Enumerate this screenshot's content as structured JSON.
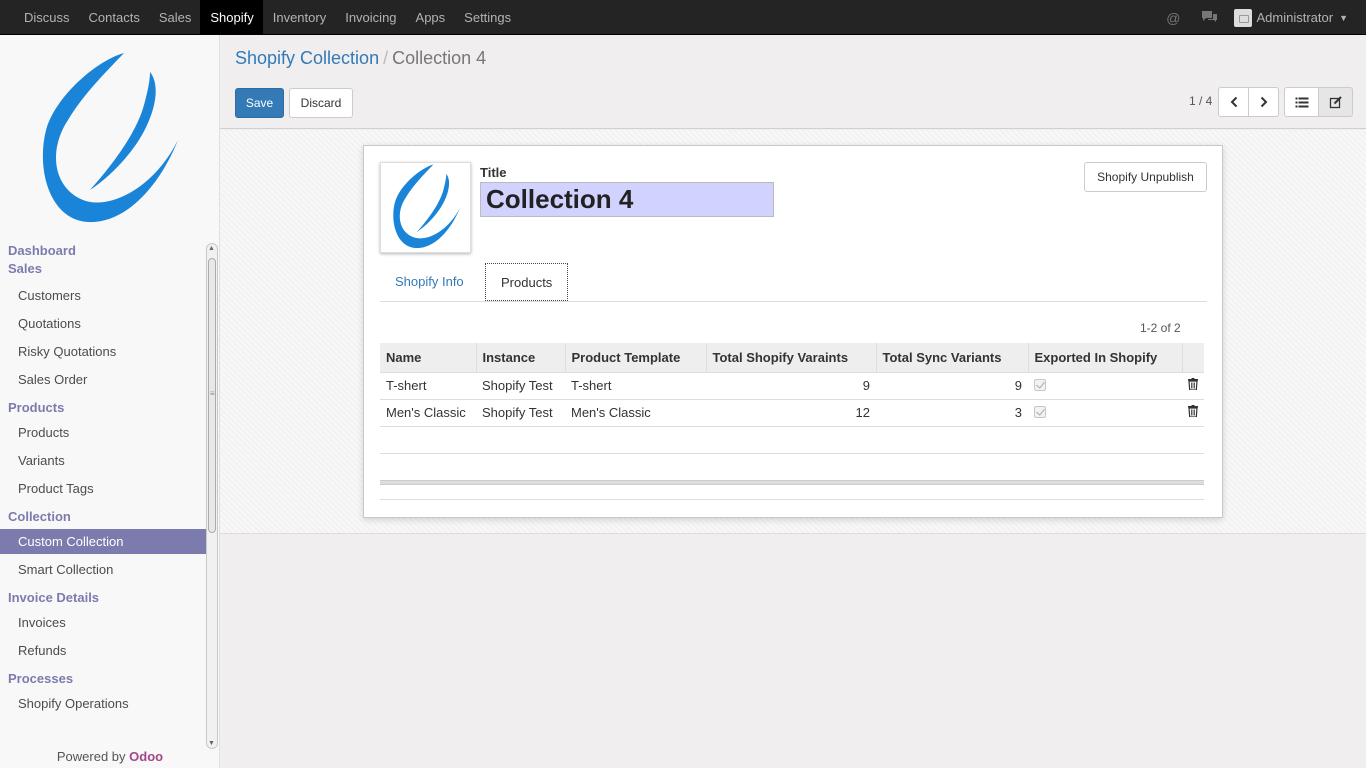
{
  "topbar": {
    "menu": [
      "Discuss",
      "Contacts",
      "Sales",
      "Shopify",
      "Inventory",
      "Invoicing",
      "Apps",
      "Settings"
    ],
    "active": "Shopify",
    "user": "Administrator",
    "icons": [
      "at-icon",
      "chat-icon"
    ]
  },
  "sidebar": {
    "sections": [
      {
        "title": "Dashboard",
        "items": []
      },
      {
        "title": "Sales",
        "items": [
          "Customers",
          "Quotations",
          "Risky Quotations",
          "Sales Order"
        ]
      },
      {
        "title": "Products",
        "items": [
          "Products",
          "Variants",
          "Product Tags"
        ]
      },
      {
        "title": "Collection",
        "items": [
          "Custom Collection",
          "Smart Collection"
        ]
      },
      {
        "title": "Invoice Details",
        "items": [
          "Invoices",
          "Refunds"
        ]
      },
      {
        "title": "Processes",
        "items": [
          "Shopify Operations"
        ]
      }
    ],
    "active_item": "Custom Collection",
    "powered_by": "Powered by",
    "brand": "Odoo"
  },
  "control_panel": {
    "breadcrumb_parent": "Shopify Collection",
    "breadcrumb_current": "Collection 4",
    "save_label": "Save",
    "discard_label": "Discard",
    "pager": "1 / 4"
  },
  "form": {
    "title_label": "Title",
    "title_value": "Collection 4",
    "unpublish_label": "Shopify Unpublish",
    "tabs": [
      "Shopify Info",
      "Products"
    ],
    "active_tab": "Products",
    "record_count": "1-2 of 2",
    "columns": [
      "Name",
      "Instance",
      "Product Template",
      "Total Shopify Varaints",
      "Total Sync Variants",
      "Exported In Shopify"
    ],
    "rows": [
      {
        "name": "T-shert",
        "instance": "Shopify Test",
        "template": "T-shert",
        "total_variants": "9",
        "sync_variants": "9",
        "exported": true
      },
      {
        "name": "Men's Classic",
        "instance": "Shopify Test",
        "template": "Men's Classic",
        "total_variants": "12",
        "sync_variants": "3",
        "exported": true
      }
    ]
  },
  "colors": {
    "topbar": "#242424",
    "accent": "#7c7bad",
    "primary": "#337ab7",
    "title_input_bg": "#d2d2ff",
    "brand": "#a24689"
  }
}
